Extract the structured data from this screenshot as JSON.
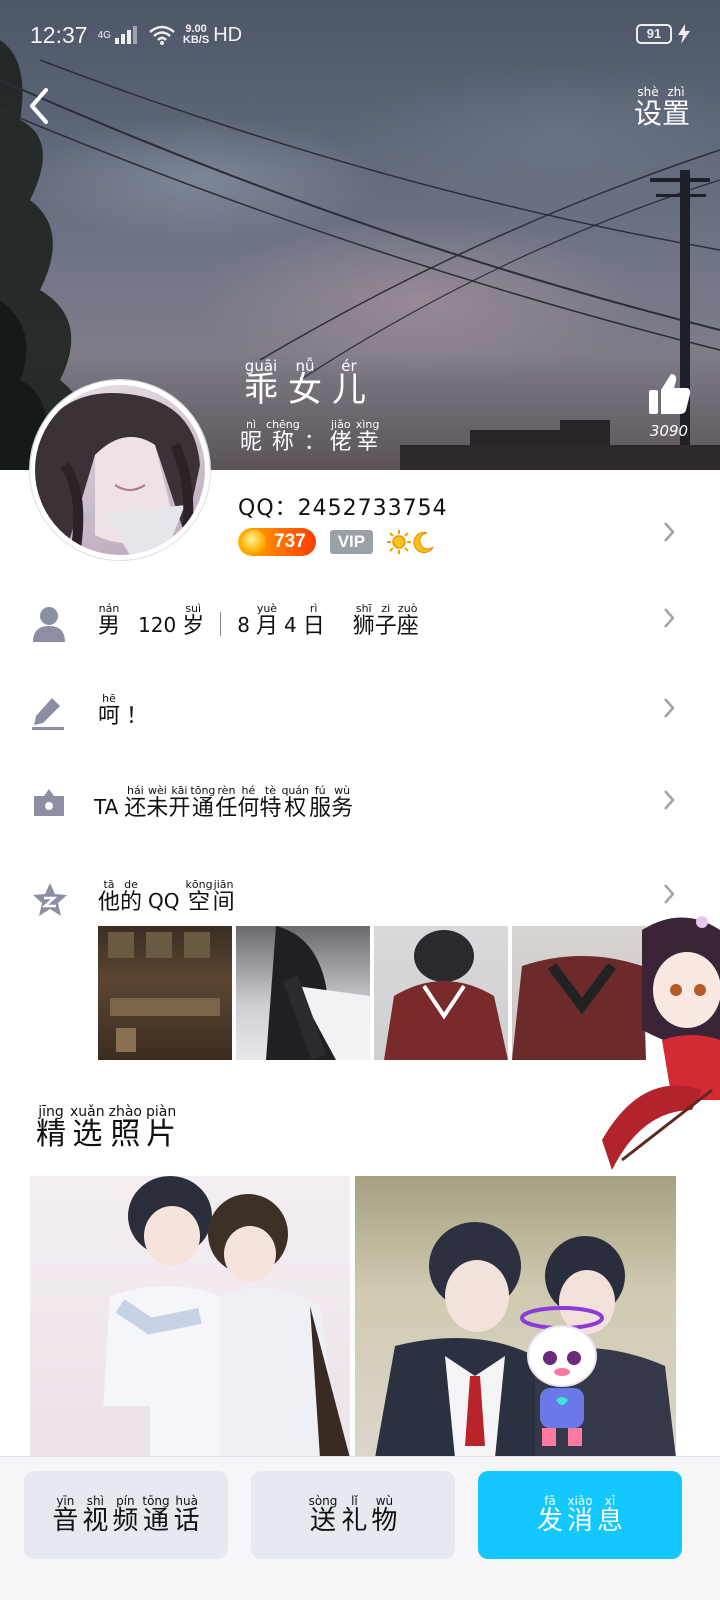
{
  "status_bar": {
    "time": "12:37",
    "network": "4G",
    "speed_value": "9.00",
    "speed_unit": "KB/S",
    "hd": "HD",
    "battery": "91"
  },
  "header": {
    "settings": [
      {
        "py": "shè",
        "hz": "设"
      },
      {
        "py": "zhì",
        "hz": "置"
      }
    ],
    "nickname": [
      {
        "py": "guāi",
        "hz": "乖"
      },
      {
        "py": "nǚ",
        "hz": "女"
      },
      {
        "py": "ér",
        "hz": "儿"
      }
    ],
    "remark": [
      {
        "py": "nì",
        "hz": "昵"
      },
      {
        "py": "chēng",
        "hz": "称"
      },
      {
        "py": "",
        "hz": "："
      },
      {
        "py": "jiǎo",
        "hz": "佬"
      },
      {
        "py": "xìng",
        "hz": "幸"
      }
    ],
    "like_count": "3090"
  },
  "profile": {
    "qq_label": "QQ：",
    "qq_number": "2452733754",
    "level": "737",
    "vip": "VIP"
  },
  "info_rows": {
    "basic": {
      "gender": [
        {
          "py": "nán",
          "hz": "男"
        }
      ],
      "age_num": "120",
      "age_unit": [
        {
          "py": "suì",
          "hz": "岁"
        }
      ],
      "birthday_prefix": "8",
      "birthday_month": [
        {
          "py": "yuè",
          "hz": "月"
        }
      ],
      "birthday_day": "4",
      "birthday_day_unit": [
        {
          "py": "rì",
          "hz": "日"
        }
      ],
      "zodiac": [
        {
          "py": "shī",
          "hz": "狮"
        },
        {
          "py": "zi",
          "hz": "子"
        },
        {
          "py": "zuò",
          "hz": "座"
        }
      ]
    },
    "signature": [
      {
        "py": "hē",
        "hz": "呵"
      },
      {
        "py": "",
        "hz": "！"
      }
    ],
    "service_prefix": "TA",
    "service": [
      {
        "py": "hái",
        "hz": "还"
      },
      {
        "py": "wèi",
        "hz": "未"
      },
      {
        "py": "kāi",
        "hz": "开"
      },
      {
        "py": "tōng",
        "hz": "通"
      },
      {
        "py": "rèn",
        "hz": "任"
      },
      {
        "py": "hé",
        "hz": "何"
      },
      {
        "py": "tè",
        "hz": "特"
      },
      {
        "py": "quán",
        "hz": "权"
      },
      {
        "py": "fú",
        "hz": "服"
      },
      {
        "py": "wù",
        "hz": "务"
      }
    ],
    "qzone_a": [
      {
        "py": "tā",
        "hz": "他"
      },
      {
        "py": "de",
        "hz": "的"
      }
    ],
    "qzone_mid": "QQ",
    "qzone_b": [
      {
        "py": "kōng",
        "hz": "空"
      },
      {
        "py": "jiān",
        "hz": "间"
      }
    ]
  },
  "featured_photos": {
    "title": [
      {
        "py": "jīng",
        "hz": "精"
      },
      {
        "py": "xuǎn",
        "hz": "选"
      },
      {
        "py": "zhào",
        "hz": "照"
      },
      {
        "py": "piàn",
        "hz": "片"
      }
    ]
  },
  "bottom_bar": {
    "call": [
      {
        "py": "yīn",
        "hz": "音"
      },
      {
        "py": "shì",
        "hz": "视"
      },
      {
        "py": "pín",
        "hz": "频"
      },
      {
        "py": "tōng",
        "hz": "通"
      },
      {
        "py": "huà",
        "hz": "话"
      }
    ],
    "gift": [
      {
        "py": "sòng",
        "hz": "送"
      },
      {
        "py": "lǐ",
        "hz": "礼"
      },
      {
        "py": "wù",
        "hz": "物"
      }
    ],
    "message": [
      {
        "py": "fā",
        "hz": "发"
      },
      {
        "py": "xiāo",
        "hz": "消"
      },
      {
        "py": "xī",
        "hz": "息"
      }
    ]
  },
  "colors": {
    "accent_blue": "#12c8ff",
    "button_gray": "#e7e9f0",
    "icon_gray": "#8c8fa3"
  },
  "icons": [
    "back-arrow-icon",
    "thumbs-up-icon",
    "person-icon",
    "pencil-icon",
    "crown-bag-icon",
    "qzone-star-icon",
    "chevron-right-icon",
    "sun-icon",
    "moon-icon"
  ]
}
